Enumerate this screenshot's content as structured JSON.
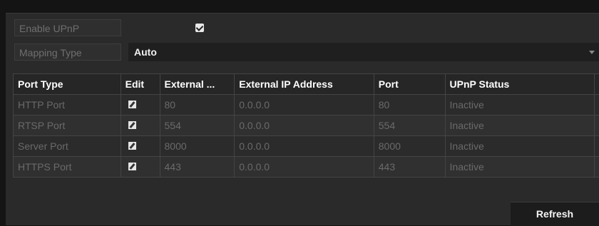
{
  "upnp": {
    "enable_label": "Enable UPnP",
    "enabled": true,
    "mapping_label": "Mapping Type",
    "mapping_value": "Auto"
  },
  "table": {
    "headers": [
      "Port Type",
      "Edit",
      "External ...",
      "External IP Address",
      "Port",
      "UPnP Status"
    ],
    "rows": [
      {
        "port_type": "HTTP Port",
        "external": "80",
        "ip": "0.0.0.0",
        "port": "80",
        "status": "Inactive"
      },
      {
        "port_type": "RTSP Port",
        "external": "554",
        "ip": "0.0.0.0",
        "port": "554",
        "status": "Inactive"
      },
      {
        "port_type": "Server Port",
        "external": "8000",
        "ip": "0.0.0.0",
        "port": "8000",
        "status": "Inactive"
      },
      {
        "port_type": "HTTPS Port",
        "external": "443",
        "ip": "0.0.0.0",
        "port": "443",
        "status": "Inactive"
      }
    ]
  },
  "buttons": {
    "refresh": "Refresh"
  },
  "icons": {
    "checkbox": "checkbox-checked-icon",
    "edit": "edit-icon",
    "dropdown": "chevron-down-icon"
  }
}
